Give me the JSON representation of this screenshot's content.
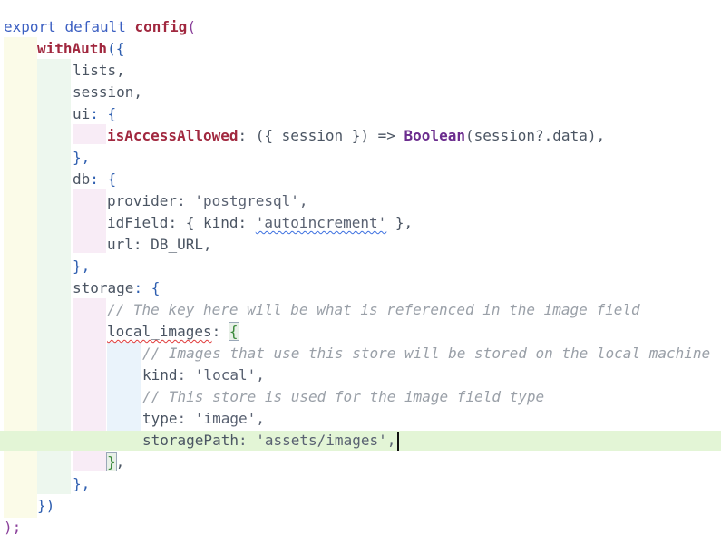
{
  "editor": {
    "language": "TypeScript",
    "colors": {
      "keyword": "#3b5fc2",
      "function": "#a1283f",
      "comment": "#9aa0a8",
      "active_line": "#e3f5d6"
    },
    "tokens": {
      "export": "export",
      "default": "default",
      "config": "config",
      "open_paren": "(",
      "withAuth": "withAuth",
      "withAuth_open": "({",
      "lists": "lists,",
      "session": "session,",
      "ui": "ui",
      "colon_brace": ": {",
      "isAccessAllowed": "isAccessAllowed",
      "arrow_args": ": ({ session }) => ",
      "Boolean": "Boolean",
      "boolean_args": "(session?.data),",
      "close_brace_comma": "},",
      "db": "db",
      "provider": "provider",
      "provider_val": ": 'postgresql',",
      "idField": "idField",
      "idField_open": ": { kind: ",
      "autoincrement": "'autoincrement'",
      "idField_close": " },",
      "url": "url",
      "url_val": ": DB_URL,",
      "storage": "storage",
      "comment1": "// The key here will be what is referenced in the image field",
      "local_images": "local_images",
      "colon": ": ",
      "open_brace": "{",
      "comment2": "// Images that use this store will be stored on the local machine",
      "kind": "kind",
      "kind_val": ": 'local',",
      "comment3": "// This store is used for the image field type",
      "type": "type",
      "type_val": ": 'image',",
      "storagePath": "storagePath",
      "storagePath_val": ": 'assets/images',",
      "close_brace": "}",
      "comma": ",",
      "withAuth_close": "})",
      "final": ");"
    }
  }
}
